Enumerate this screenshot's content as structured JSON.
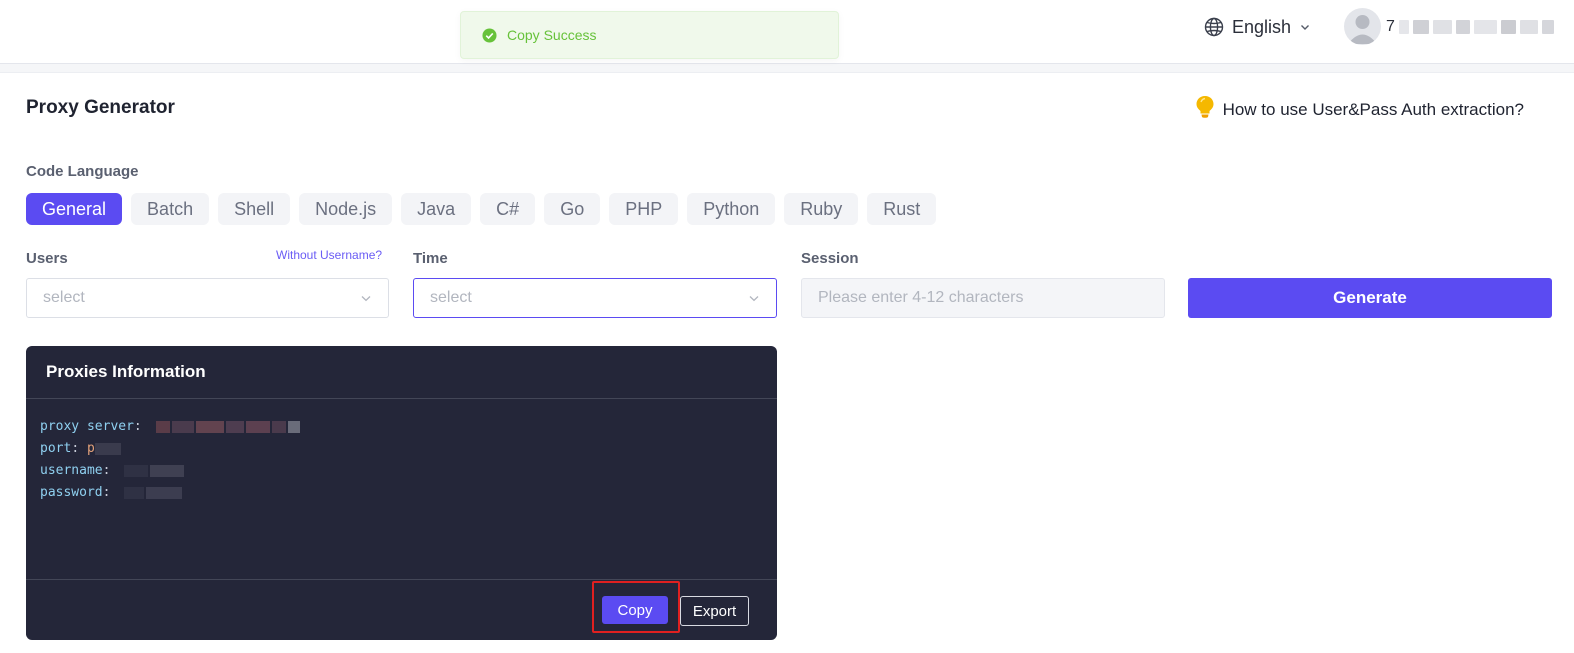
{
  "toast": {
    "message": "Copy Success",
    "color": "#67c23a"
  },
  "header": {
    "language_label": "English",
    "user_name_visible": "7"
  },
  "page": {
    "title": "Proxy Generator",
    "help_link": "How to use User&Pass Auth extraction?"
  },
  "code_language": {
    "label": "Code Language",
    "tabs": [
      "General",
      "Batch",
      "Shell",
      "Node.js",
      "Java",
      "C#",
      "Go",
      "PHP",
      "Python",
      "Ruby",
      "Rust"
    ],
    "selected": "General"
  },
  "form": {
    "users": {
      "label": "Users",
      "placeholder": "select",
      "extra_link": "Without Username?"
    },
    "time": {
      "label": "Time",
      "placeholder": "select"
    },
    "session": {
      "label": "Session",
      "placeholder": "Please enter 4-12 characters"
    },
    "generate_label": "Generate"
  },
  "proxies": {
    "title": "Proxies Information",
    "lines": [
      {
        "key": "proxy server",
        "value_visible": ""
      },
      {
        "key": "port",
        "value_visible": "p"
      },
      {
        "key": "username",
        "value_visible": ""
      },
      {
        "key": "password",
        "value_visible": ""
      }
    ],
    "copy_label": "Copy",
    "export_label": "Export"
  },
  "colors": {
    "accent": "#5b4bf2",
    "panel_bg": "#242639",
    "highlight_box": "#e02020"
  }
}
